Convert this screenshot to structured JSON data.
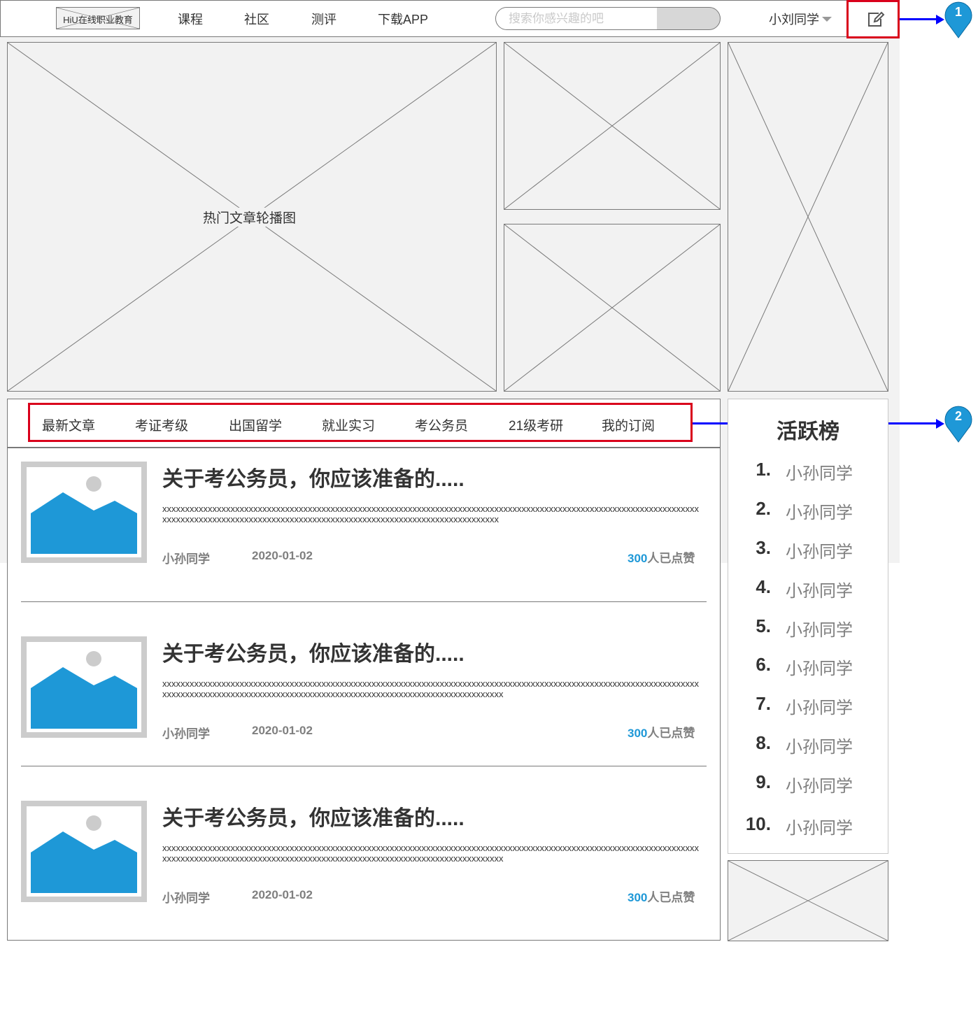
{
  "header": {
    "logo": "HiU在线职业教育",
    "nav": [
      "课程",
      "社区",
      "测评",
      "下载APP"
    ],
    "search_placeholder": "搜索你感兴趣的吧",
    "user": "小刘同学"
  },
  "banner": {
    "carousel_label": "热门文章轮播图"
  },
  "tabs": [
    "最新文章",
    "考证考级",
    "出国留学",
    "就业实习",
    "考公务员",
    "21级考研",
    "我的订阅"
  ],
  "articles": [
    {
      "title": "关于考公务员，你应该准备的.....",
      "body": "xxxxxxxxxxxxxxxxxxxxxxxxxxxxxxxxxxxxxxxxxxxxxxxxxxxxxxxxxxxxxxxxxxxxxxxxxxxxxxxxxxxxxxxxxxxxxxxxxxxxxxxxxxxxxxxxxxxxxxxxxxxxxxxxxxxxxxxxxxxxxxxxxxxxxxxxxxxxxxxxxxxxxxxxxxxxxxxxxxxxxxxxxxxxxxxx",
      "author": "小孙同学",
      "date": "2020-01-02",
      "likes_count": "300",
      "likes_text": "人已点赞"
    },
    {
      "title": "关于考公务员，你应该准备的.....",
      "body": "xxxxxxxxxxxxxxxxxxxxxxxxxxxxxxxxxxxxxxxxxxxxxxxxxxxxxxxxxxxxxxxxxxxxxxxxxxxxxxxxxxxxxxxxxxxxxxxxxxxxxxxxxxxxxxxxxxxxxxxxxxxxxxxxxxxxxxxxxxxxxxxxxxxxxxxxxxxxxxxxxxxxxxxxxxxxxxxxxxxxxxxxxxxxxxxxx",
      "author": "小孙同学",
      "date": "2020-01-02",
      "likes_count": "300",
      "likes_text": "人已点赞"
    },
    {
      "title": "关于考公务员，你应该准备的.....",
      "body": "xxxxxxxxxxxxxxxxxxxxxxxxxxxxxxxxxxxxxxxxxxxxxxxxxxxxxxxxxxxxxxxxxxxxxxxxxxxxxxxxxxxxxxxxxxxxxxxxxxxxxxxxxxxxxxxxxxxxxxxxxxxxxxxxxxxxxxxxxxxxxxxxxxxxxxxxxxxxxxxxxxxxxxxxxxxxxxxxxxxxxxxxxxxxxxxxx",
      "author": "小孙同学",
      "date": "2020-01-02",
      "likes_count": "300",
      "likes_text": "人已点赞"
    }
  ],
  "ranking": {
    "title": "活跃榜",
    "items": [
      {
        "num": "1.",
        "name": "小孙同学"
      },
      {
        "num": "2.",
        "name": "小孙同学"
      },
      {
        "num": "3.",
        "name": "小孙同学"
      },
      {
        "num": "4.",
        "name": "小孙同学"
      },
      {
        "num": "5.",
        "name": "小孙同学"
      },
      {
        "num": "6.",
        "name": "小孙同学"
      },
      {
        "num": "7.",
        "name": "小孙同学"
      },
      {
        "num": "8.",
        "name": "小孙同学"
      },
      {
        "num": "9.",
        "name": "小孙同学"
      },
      {
        "num": "10.",
        "name": "小孙同学"
      }
    ]
  },
  "annotations": [
    "1",
    "2"
  ],
  "colors": {
    "highlight": "#d9001b",
    "accent": "#1e98d7",
    "connector": "#0000ff",
    "placeholder_fill": "#f2f2f2"
  }
}
